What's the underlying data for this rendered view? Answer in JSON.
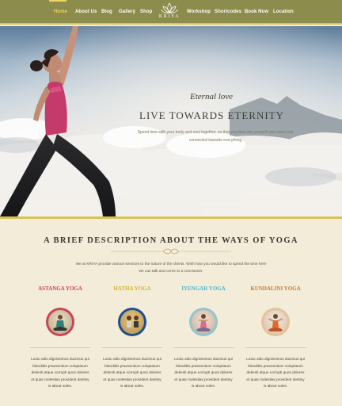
{
  "nav": {
    "items": [
      "Home",
      "About Us",
      "Blog",
      "Gallery",
      "Shop",
      "Workshop",
      "Shortcodes",
      "Book Now",
      "Location"
    ],
    "active": "Home",
    "logo_text": "KRIYA",
    "bar_color": "#8c8c4c",
    "accent_color": "#f3d45a"
  },
  "hero": {
    "script_text": "Eternal love",
    "title": "LIVE TOWARDS ETERNITY",
    "subtitle": "Spend time with your body and soul together, so that you dive into yourself absorbed and connected towards everything"
  },
  "section": {
    "title": "A BRIEF DESCRIPTION ABOUT THE WAYS OF YOGA",
    "intro": "We at KRIYA provide various services to the nature of the clients. Wish how you would like to spend the time here we can talk and come to a conclusion."
  },
  "styles": [
    {
      "name": "ASTANGA YOGA",
      "color": "#c9445d",
      "text": "Lusto odio dignissimos ducimus qui blanditiis praesentium voluptatum deleniti atque corrupti quos dolores et quas molestias provident destiny is about voles."
    },
    {
      "name": "HATHA YOGA",
      "color": "#d8b428",
      "text": "Lusto odio dignissimos ducimus qui blanditiis praesentium voluptatum deleniti atque corrupti quos dolores et quas molestias provident destiny is about voles."
    },
    {
      "name": "IYENGAR YOGA",
      "color": "#4cb6c9",
      "text": "Lusto odio dignissimos ducimus qui blanditiis praesentium voluptatum deleniti atque corrupti quos dolores et quas molestias provident destiny is about voles."
    },
    {
      "name": "KUNDALINI YOGA",
      "color": "#d3762f",
      "text": "Lusto odio dignissimos ducimus qui blanditiis praesentium voluptatum deleniti atque corrupti quos dolores et quas molestias provident destiny is about voles."
    }
  ]
}
